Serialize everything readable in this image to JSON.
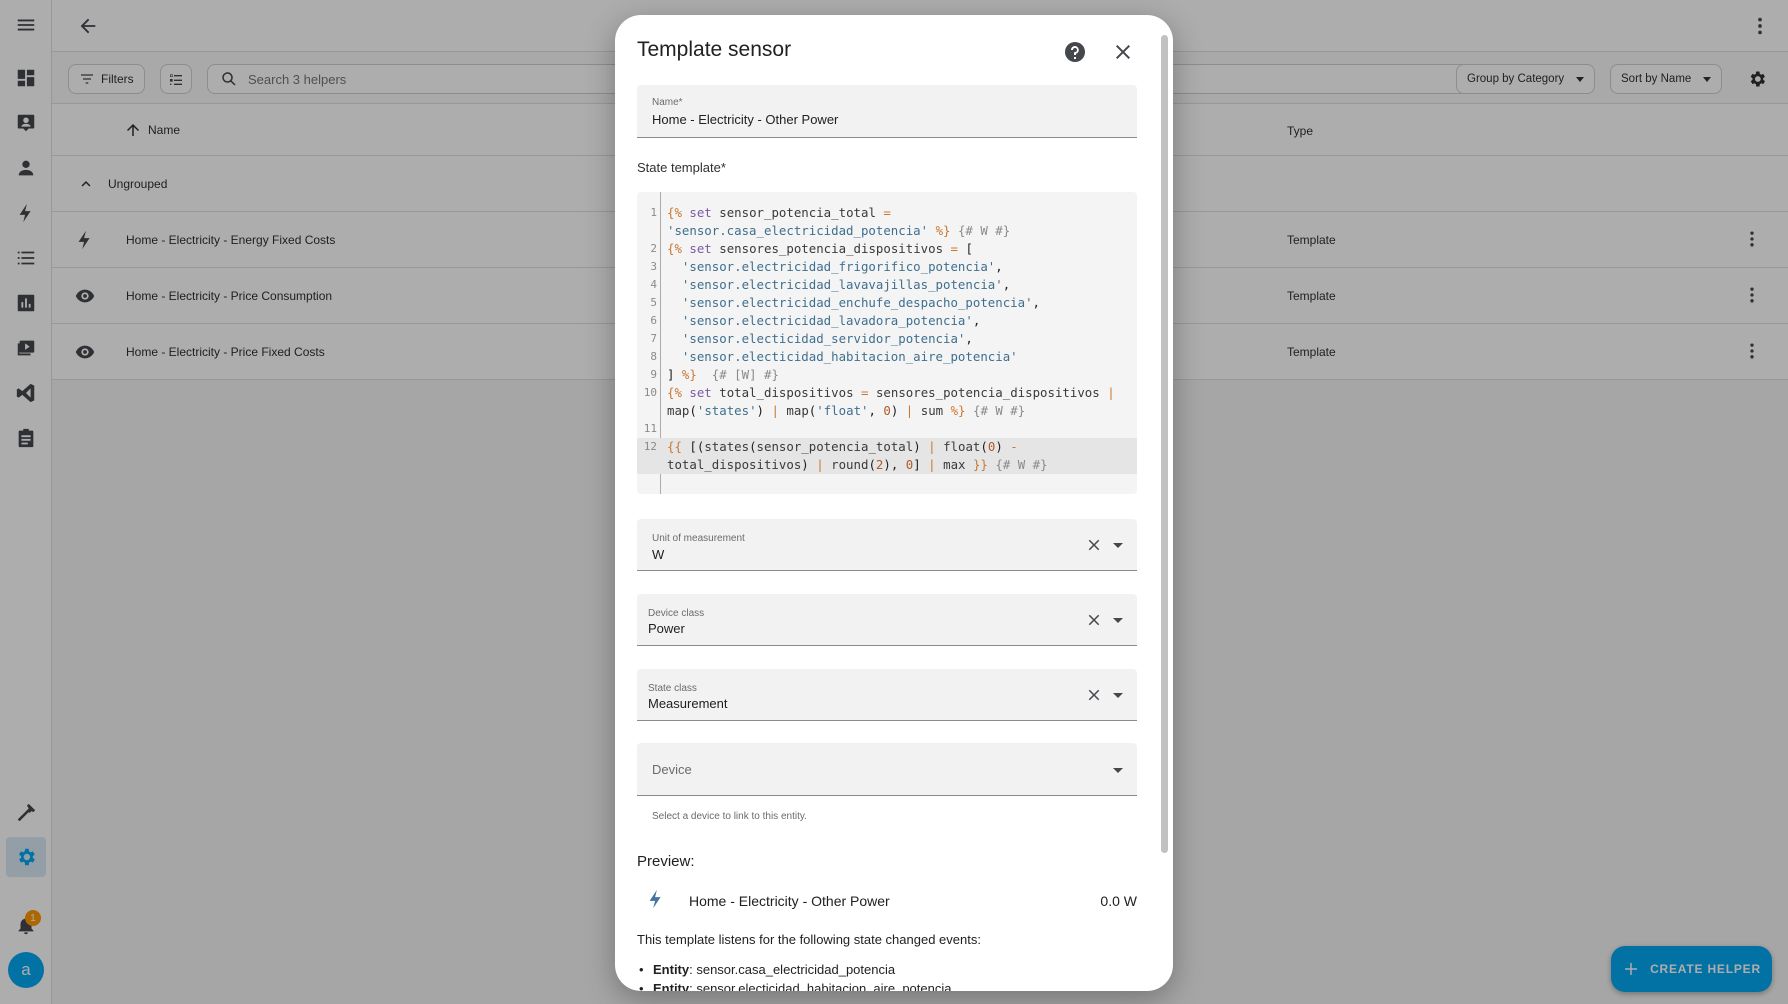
{
  "sidebar": {
    "items": [
      {
        "icon": "menu-icon"
      },
      {
        "icon": "dashboard-icon"
      },
      {
        "icon": "account-box-icon"
      },
      {
        "icon": "person-icon"
      },
      {
        "icon": "lightning-icon"
      },
      {
        "icon": "list-icon"
      },
      {
        "icon": "chart-box-icon"
      },
      {
        "icon": "media-icon"
      },
      {
        "icon": "vscode-icon"
      },
      {
        "icon": "clipboard-icon"
      },
      {
        "icon": "hammer-icon"
      },
      {
        "icon": "gear-icon"
      },
      {
        "icon": "bell-icon"
      }
    ],
    "notification_count": "1",
    "avatar_letter": "a"
  },
  "toolbar": {
    "filters_label": "Filters",
    "search_placeholder": "Search 3 helpers",
    "group_by_label": "Group by Category",
    "sort_by_label": "Sort by Name"
  },
  "table": {
    "columns": {
      "name": "Name",
      "type": "Type"
    },
    "group_label": "Ungrouped",
    "rows": [
      {
        "icon": "lightning-icon",
        "name": "Home - Electricity - Energy Fixed Costs",
        "type": "Template"
      },
      {
        "icon": "eye-icon",
        "name": "Home - Electricity - Price Consumption",
        "type": "Template"
      },
      {
        "icon": "eye-icon",
        "name": "Home - Electricity - Price Fixed Costs",
        "type": "Template"
      }
    ]
  },
  "fab": {
    "label": "CREATE HELPER"
  },
  "dialog": {
    "title": "Template sensor",
    "name_field": {
      "label": "Name*",
      "value": "Home - Electricity - Other Power"
    },
    "state_template_label": "State template*",
    "code_lines": [
      {
        "n": "1",
        "text": "{% set sensor_potencia_total ="
      },
      {
        "n": "",
        "text": "'sensor.casa_electricidad_potencia' %} {# W #}"
      },
      {
        "n": "2",
        "text": "{% set sensores_potencia_dispositivos = ["
      },
      {
        "n": "3",
        "text": "  'sensor.electricidad_frigorifico_potencia',"
      },
      {
        "n": "4",
        "text": "  'sensor.electricidad_lavavajillas_potencia',"
      },
      {
        "n": "5",
        "text": "  'sensor.electricidad_enchufe_despacho_potencia',"
      },
      {
        "n": "6",
        "text": "  'sensor.electricidad_lavadora_potencia',"
      },
      {
        "n": "7",
        "text": "  'sensor.electicidad_servidor_potencia',"
      },
      {
        "n": "8",
        "text": "  'sensor.electicidad_habitacion_aire_potencia'"
      },
      {
        "n": "9",
        "text": "] %}  {# [W] #}"
      },
      {
        "n": "10",
        "text": "{% set total_dispositivos = sensores_potencia_dispositivos |"
      },
      {
        "n": "",
        "text": "map('states') | map('float', 0) | sum %} {# W #}"
      },
      {
        "n": "11",
        "text": ""
      },
      {
        "n": "12",
        "text": "{{ [(states(sensor_potencia_total) | float(0) -"
      },
      {
        "n": "",
        "text": "total_dispositivos) | round(2), 0] | max }} {# W #}"
      }
    ],
    "unit_field": {
      "label": "Unit of measurement",
      "value": "W"
    },
    "device_class_field": {
      "label": "Device class",
      "value": "Power"
    },
    "state_class_field": {
      "label": "State class",
      "value": "Measurement"
    },
    "device_field": {
      "placeholder": "Device",
      "helper": "Select a device to link to this entity."
    },
    "preview": {
      "title": "Preview:",
      "icon": "lightning-icon",
      "name": "Home - Electricity - Other Power",
      "value": "0.0 W"
    },
    "listen_text": "This template listens for the following state changed events:",
    "entities": [
      {
        "label": "Entity",
        "value": ": sensor.casa_electricidad_potencia"
      },
      {
        "label": "Entity",
        "value": ": sensor.electicidad_habitacion_aire_potencia"
      }
    ]
  },
  "colors": {
    "accent": "#03a9f4",
    "badge": "#ff9800"
  }
}
